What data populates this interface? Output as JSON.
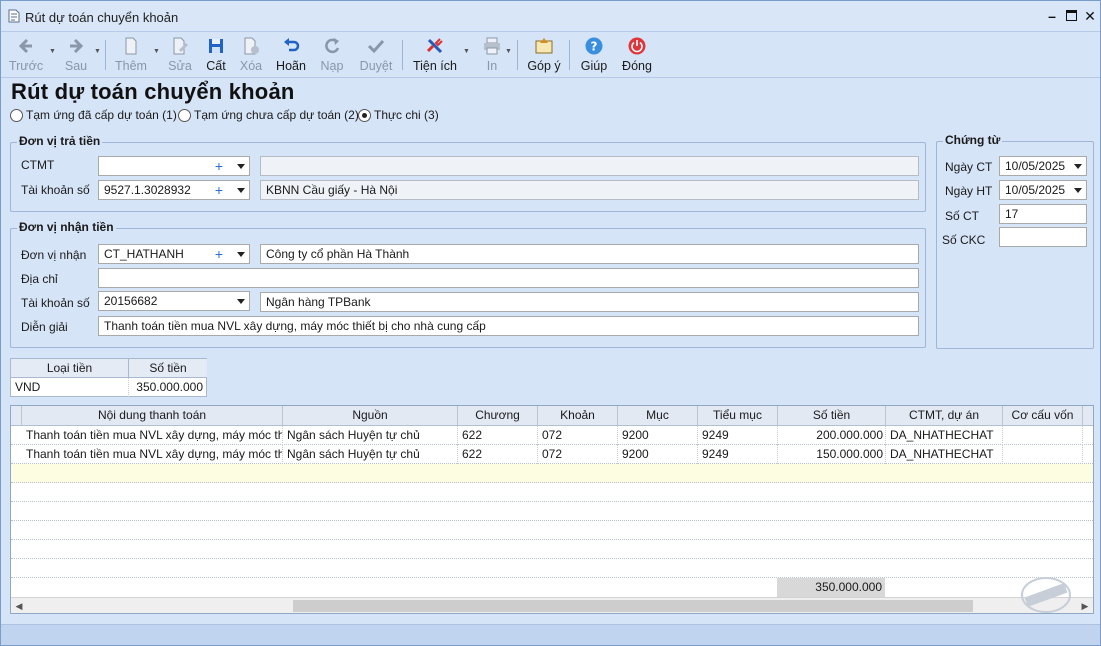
{
  "window": {
    "title": "Rút dự toán chuyển khoản"
  },
  "toolbar": {
    "prev": "Trước",
    "next": "Sau",
    "add": "Thêm",
    "edit": "Sửa",
    "save": "Cất",
    "delete": "Xóa",
    "undo": "Hoãn",
    "load": "Nạp",
    "approve": "Duyệt",
    "utilities": "Tiện ích",
    "print": "In",
    "feedback": "Góp ý",
    "help": "Giúp",
    "close": "Đóng"
  },
  "page": {
    "heading": "Rút dự toán chuyển khoản",
    "radio_options": [
      {
        "label": "Tạm ứng đã cấp dự toán (1)",
        "selected": false
      },
      {
        "label": "Tạm ứng chưa cấp dự toán (2)",
        "selected": false
      },
      {
        "label": "Thực chi (3)",
        "selected": true
      }
    ]
  },
  "payer": {
    "title": "Đơn vị trả tiền",
    "ctmt_label": "CTMT",
    "ctmt_value": "",
    "ctmt_name": "",
    "account_label": "Tài khoản số",
    "account_value": "9527.1.3028932",
    "account_name": "KBNN Cầu giấy - Hà Nội"
  },
  "receiver": {
    "title": "Đơn vị nhận tiền",
    "unit_label": "Đơn vị nhận",
    "unit_code": "CT_HATHANH",
    "unit_name": "Công ty cổ phần Hà Thành",
    "address_label": "Địa chỉ",
    "address_value": "",
    "account_label": "Tài khoản số",
    "account_value": "20156682",
    "bank_name": "Ngân hàng TPBank",
    "desc_label": "Diễn giải",
    "desc_value": "Thanh toán tiền mua NVL xây dựng, máy móc thiết bị cho nhà cung cấp"
  },
  "voucher": {
    "title": "Chứng từ",
    "date_ct_label": "Ngày CT",
    "date_ct": "10/05/2025",
    "date_ht_label": "Ngày HT",
    "date_ht": "10/05/2025",
    "no_ct_label": "Số CT",
    "no_ct": "17",
    "no_ckc_label": "Số CKC",
    "no_ckc": ""
  },
  "currency_table": {
    "headers": [
      "Loại tiền",
      "Số tiền"
    ],
    "currency": "VND",
    "amount": "350.000.000"
  },
  "grid": {
    "headers": [
      "Nội dung thanh toán",
      "Nguồn",
      "Chương",
      "Khoản",
      "Mục",
      "Tiểu mục",
      "Số tiền",
      "CTMT, dự án",
      "Cơ cấu vốn"
    ],
    "rows": [
      [
        "Thanh toán tiền mua NVL xây dựng, máy móc thi...",
        "Ngân sách Huyện tự chủ",
        "622",
        "072",
        "9200",
        "9249",
        "200.000.000",
        "DA_NHATHECHAT",
        ""
      ],
      [
        "Thanh toán tiền mua NVL xây dựng, máy móc thi...",
        "Ngân sách Huyện tự chủ",
        "622",
        "072",
        "9200",
        "9249",
        "150.000.000",
        "DA_NHATHECHAT",
        ""
      ]
    ],
    "total": "350.000.000"
  },
  "colors": {
    "accent": "#2a6fd6",
    "close_red": "#e0353b",
    "help_blue": "#3a8ee0"
  }
}
